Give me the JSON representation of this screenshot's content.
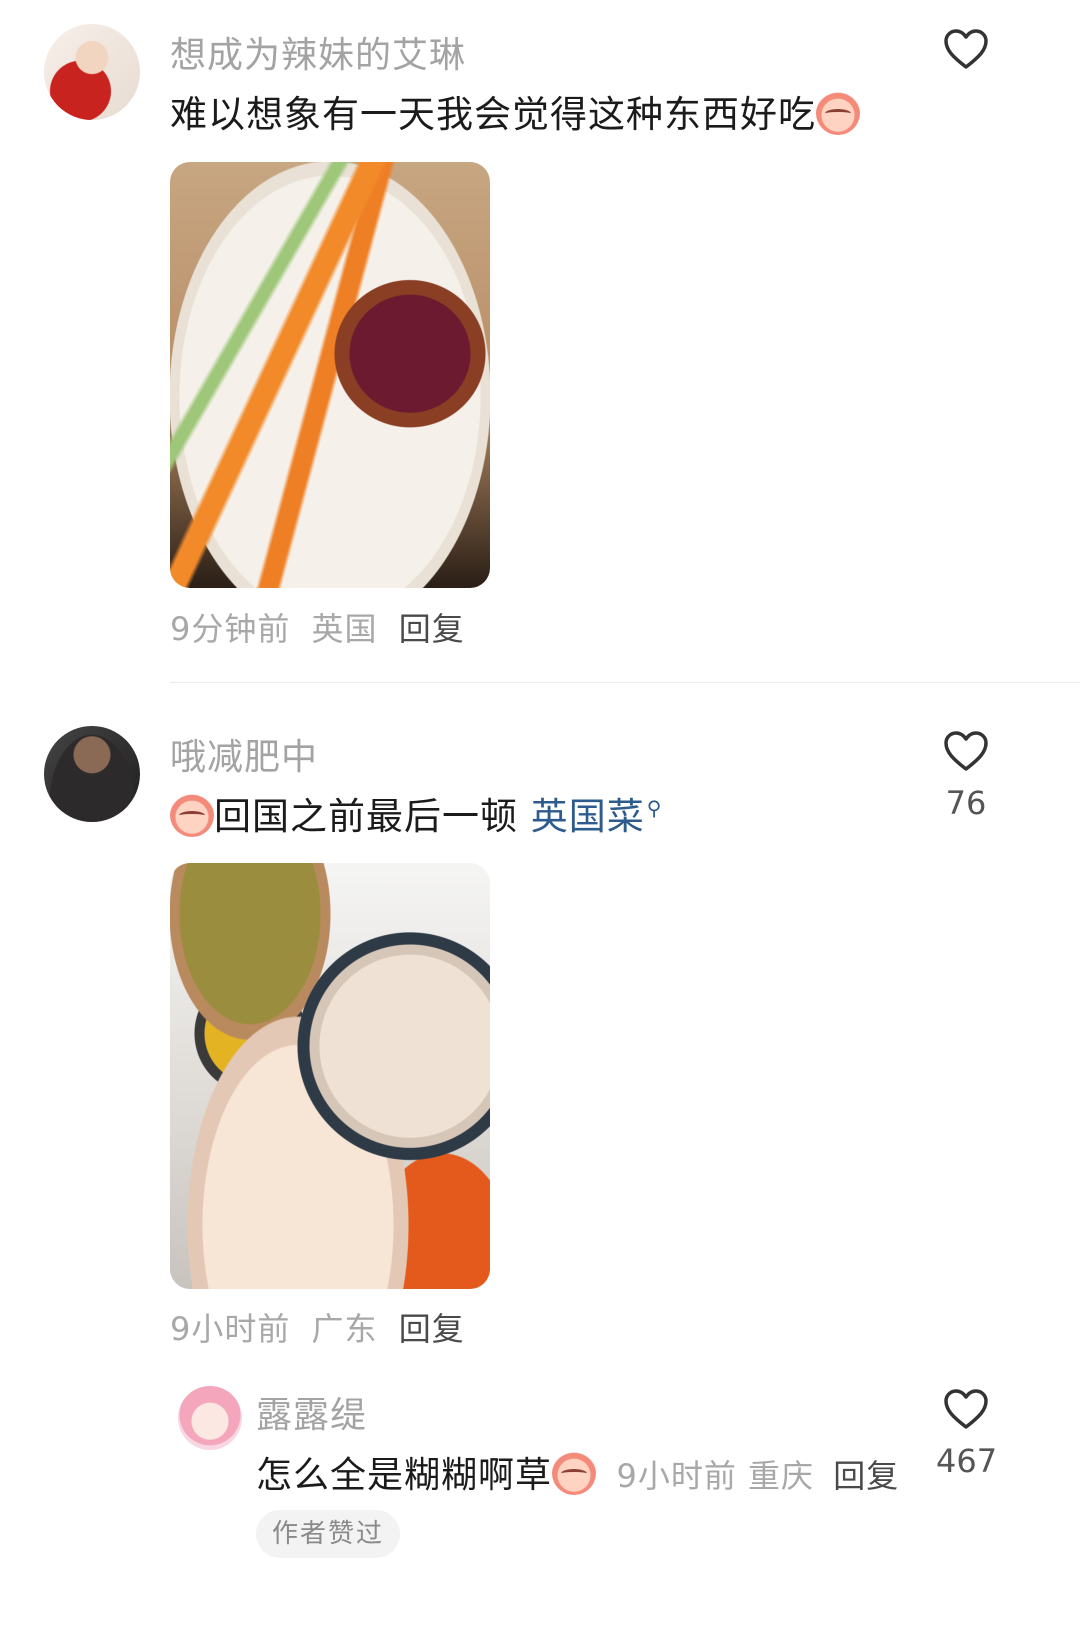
{
  "comments": [
    {
      "username": "想成为辣妹的艾琳",
      "text": "难以想象有一天我会觉得这种东西好吃",
      "emoji": "crying-face",
      "time": "9分钟前",
      "region": "英国",
      "reply_label": "回复",
      "likes": ""
    },
    {
      "username": "哦减肥中",
      "text": "回国之前最后一顿",
      "topic": "英国菜",
      "emoji": "watermelon-face",
      "time": "9小时前",
      "region": "广东",
      "reply_label": "回复",
      "likes": "76"
    }
  ],
  "reply": {
    "username": "露露缇",
    "text": "怎么全是糊糊啊草",
    "emoji": "crying-face",
    "time": "9小时前",
    "region": "重庆",
    "reply_label": "回复",
    "likes": "467",
    "badge": "作者赞过"
  },
  "colors": {
    "topic": "#2e5b8e",
    "muted": "#a8a8a8",
    "text": "#1b1b1b"
  }
}
